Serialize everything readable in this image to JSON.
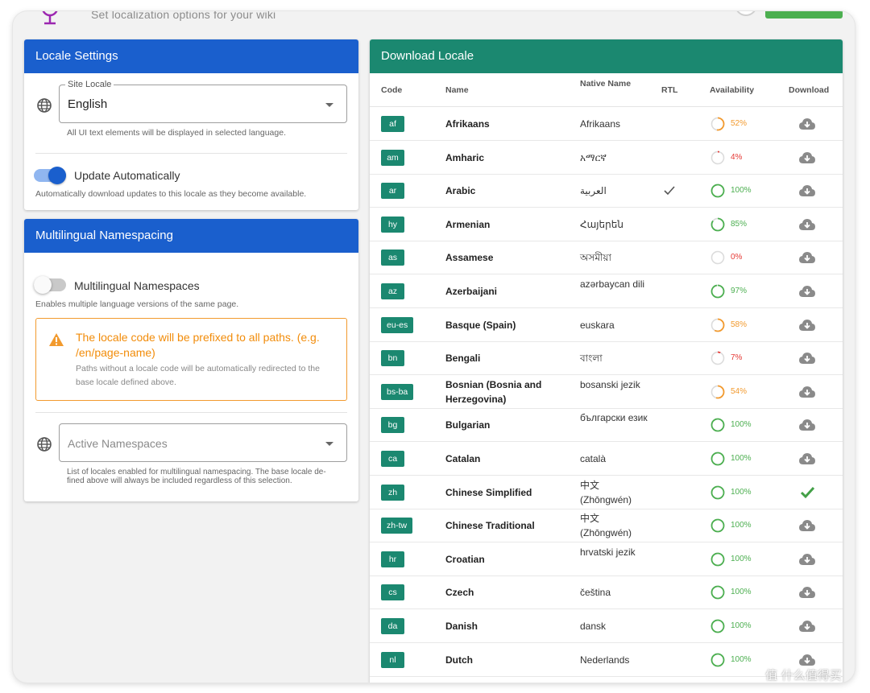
{
  "header": {
    "subtitle": "Set localization options for your wiki"
  },
  "locale_settings": {
    "title": "Locale Settings",
    "site_locale_label": "Site Locale",
    "site_locale_value": "English",
    "site_locale_hint": "All UI text elements will be displayed in selected language.",
    "update_auto_label": "Update Automatically",
    "update_auto_on": true,
    "update_auto_hint": "Automatically download updates to this locale as they become available."
  },
  "namespacing": {
    "title": "Multilingual Namespacing",
    "toggle_label": "Multilingual Namespaces",
    "toggle_on": false,
    "toggle_hint": "Enables multiple language versions of the same page.",
    "alert_title": "The locale code will be prefixed to all paths. (e.g. /en/page-name)",
    "alert_body": "Paths without a locale code will be automatically redirected to the base locale defined above.",
    "active_placeholder": "Active Namespaces",
    "active_hint": "List of locales enabled for multilingual namespacing. The base locale de-fined above will always be included regardless of this selection."
  },
  "download": {
    "title": "Download Locale",
    "columns": {
      "code": "Code",
      "name": "Name",
      "native": "Native Name",
      "rtl": "RTL",
      "availability": "Availability",
      "download": "Download"
    },
    "rows": [
      {
        "code": "af",
        "name": "Afrikaans",
        "native": "Afrikaans",
        "rtl": false,
        "pct": "52%",
        "level": 52,
        "installed": false
      },
      {
        "code": "am",
        "name": "Amharic",
        "native": "አማርኛ",
        "rtl": false,
        "pct": "4%",
        "level": 4,
        "installed": false
      },
      {
        "code": "ar",
        "name": "Arabic",
        "native": "العربية",
        "rtl": true,
        "pct": "100%",
        "level": 100,
        "installed": false
      },
      {
        "code": "hy",
        "name": "Armenian",
        "native": "Հայերեն",
        "rtl": false,
        "pct": "85%",
        "level": 85,
        "installed": false
      },
      {
        "code": "as",
        "name": "Assamese",
        "native": "অসমীয়া",
        "rtl": false,
        "pct": "0%",
        "level": 0,
        "installed": false
      },
      {
        "code": "az",
        "name": "Azerbaijani",
        "native": "azərbaycan dili",
        "rtl": false,
        "pct": "97%",
        "level": 97,
        "installed": false
      },
      {
        "code": "eu-es",
        "name": "Basque (Spain)",
        "native": "euskara",
        "rtl": false,
        "pct": "58%",
        "level": 58,
        "installed": false
      },
      {
        "code": "bn",
        "name": "Bengali",
        "native": "বাংলা",
        "rtl": false,
        "pct": "7%",
        "level": 7,
        "installed": false
      },
      {
        "code": "bs-ba",
        "name": "Bosnian (Bosnia and Herzegovina)",
        "native": "bosanski jezik",
        "rtl": false,
        "pct": "54%",
        "level": 54,
        "installed": false
      },
      {
        "code": "bg",
        "name": "Bulgarian",
        "native": "български език",
        "rtl": false,
        "pct": "100%",
        "level": 100,
        "installed": false
      },
      {
        "code": "ca",
        "name": "Catalan",
        "native": "català",
        "rtl": false,
        "pct": "100%",
        "level": 100,
        "installed": false
      },
      {
        "code": "zh",
        "name": "Chinese Simplified",
        "native": "中文 (Zhōngwén)",
        "rtl": false,
        "pct": "100%",
        "level": 100,
        "installed": true
      },
      {
        "code": "zh-tw",
        "name": "Chinese Traditional",
        "native": "中文 (Zhōngwén)",
        "rtl": false,
        "pct": "100%",
        "level": 100,
        "installed": false
      },
      {
        "code": "hr",
        "name": "Croatian",
        "native": "hrvatski jezik",
        "rtl": false,
        "pct": "100%",
        "level": 100,
        "installed": false
      },
      {
        "code": "cs",
        "name": "Czech",
        "native": "čeština",
        "rtl": false,
        "pct": "100%",
        "level": 100,
        "installed": false
      },
      {
        "code": "da",
        "name": "Danish",
        "native": "dansk",
        "rtl": false,
        "pct": "100%",
        "level": 100,
        "installed": false
      },
      {
        "code": "nl",
        "name": "Dutch",
        "native": "Nederlands",
        "rtl": false,
        "pct": "100%",
        "level": 100,
        "installed": false
      }
    ]
  },
  "colors": {
    "blue_header": "#1a5fcd",
    "teal_header": "#1b8870",
    "ok": "#4caf50",
    "warn": "#f29a2e",
    "low": "#e53935"
  },
  "watermark": "值 什么值得买"
}
